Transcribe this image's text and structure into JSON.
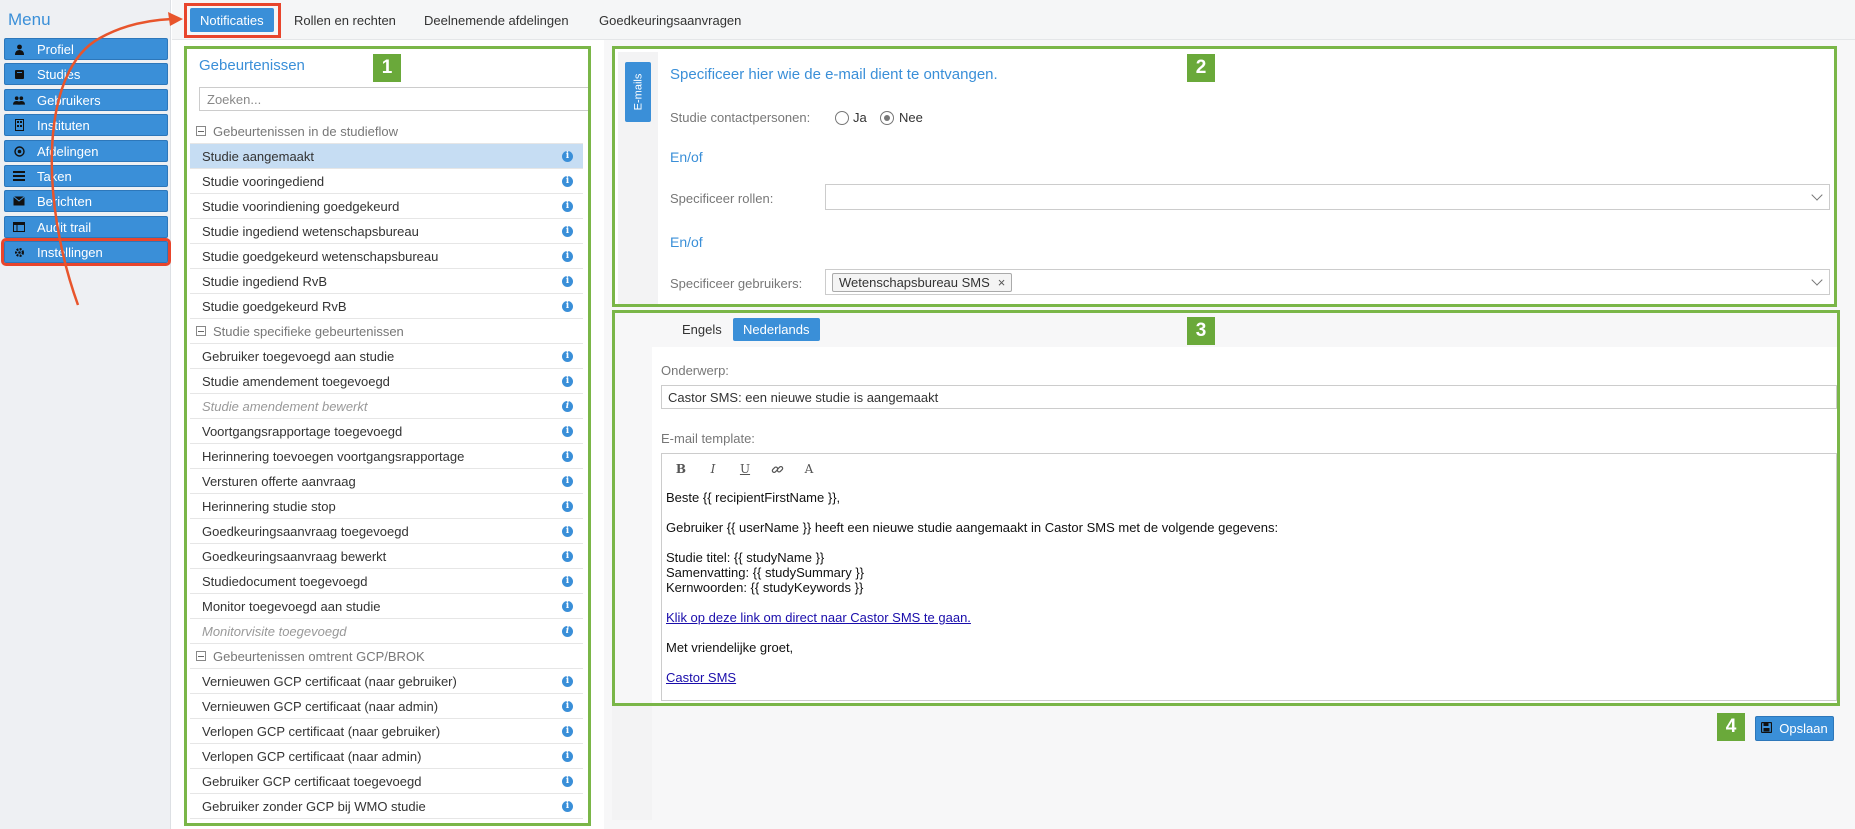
{
  "sidebar": {
    "title": "Menu",
    "items": [
      {
        "label": "Profiel",
        "icon": "user-icon"
      },
      {
        "label": "Studies",
        "icon": "book-icon"
      },
      {
        "label": "Gebruikers",
        "icon": "users-icon"
      },
      {
        "label": "Instituten",
        "icon": "building-icon"
      },
      {
        "label": "Afdelingen",
        "icon": "circle-dot-icon"
      },
      {
        "label": "Taken",
        "icon": "tasks-icon"
      },
      {
        "label": "Berichten",
        "icon": "envelope-icon"
      },
      {
        "label": "Audit trail",
        "icon": "table-icon"
      },
      {
        "label": "Instellingen",
        "icon": "gear-icon"
      }
    ],
    "active_item": "Instellingen"
  },
  "tabs": [
    "Notificaties",
    "Rollen en rechten",
    "Deelnemende afdelingen",
    "Goedkeuringsaanvragen"
  ],
  "active_tab": "Notificaties",
  "events_panel": {
    "title": "Gebeurtenissen",
    "search_placeholder": "Zoeken...",
    "groups": [
      {
        "label": "Gebeurtenissen in de studieflow",
        "items": [
          {
            "label": "Studie aangemaakt",
            "state": "selected"
          },
          {
            "label": "Studie vooringediend",
            "state": "normal"
          },
          {
            "label": "Studie voorindiening goedgekeurd",
            "state": "normal"
          },
          {
            "label": "Studie ingediend wetenschapsbureau",
            "state": "normal"
          },
          {
            "label": "Studie goedgekeurd wetenschapsbureau",
            "state": "normal"
          },
          {
            "label": "Studie ingediend RvB",
            "state": "normal"
          },
          {
            "label": "Studie goedgekeurd RvB",
            "state": "normal"
          }
        ]
      },
      {
        "label": "Studie specifieke gebeurtenissen",
        "items": [
          {
            "label": "Gebruiker toegevoegd aan studie",
            "state": "normal"
          },
          {
            "label": "Studie amendement toegevoegd",
            "state": "normal"
          },
          {
            "label": "Studie amendement bewerkt",
            "state": "disabled"
          },
          {
            "label": "Voortgangsrapportage toegevoegd",
            "state": "normal"
          },
          {
            "label": "Herinnering toevoegen voortgangsrapportage",
            "state": "normal"
          },
          {
            "label": "Versturen offerte aanvraag",
            "state": "normal"
          },
          {
            "label": "Herinnering studie stop",
            "state": "normal"
          },
          {
            "label": "Goedkeuringsaanvraag toegevoegd",
            "state": "normal"
          },
          {
            "label": "Goedkeuringsaanvraag bewerkt",
            "state": "normal"
          },
          {
            "label": "Studiedocument toegevoegd",
            "state": "normal"
          },
          {
            "label": "Monitor toegevoegd aan studie",
            "state": "normal"
          },
          {
            "label": "Monitorvisite toegevoegd",
            "state": "disabled"
          }
        ]
      },
      {
        "label": "Gebeurtenissen omtrent GCP/BROK",
        "items": [
          {
            "label": "Vernieuwen GCP certificaat (naar gebruiker)",
            "state": "normal"
          },
          {
            "label": "Vernieuwen GCP certificaat (naar admin)",
            "state": "normal"
          },
          {
            "label": "Verlopen GCP certificaat (naar gebruiker)",
            "state": "normal"
          },
          {
            "label": "Verlopen GCP certificaat (naar admin)",
            "state": "normal"
          },
          {
            "label": "Gebruiker GCP certificaat toegevoegd",
            "state": "normal"
          },
          {
            "label": "Gebruiker zonder GCP bij WMO studie",
            "state": "normal"
          }
        ]
      }
    ]
  },
  "recipients_panel": {
    "vertical_tab": "E-mails",
    "heading": "Specificeer hier wie de e-mail dient te ontvangen.",
    "contact_label": "Studie contactpersonen:",
    "radio_yes": "Ja",
    "radio_no": "Nee",
    "radio_selected": "Nee",
    "andor_1": "En/of",
    "roles_label": "Specificeer rollen:",
    "andor_2": "En/of",
    "users_label": "Specificeer gebruikers:",
    "users_tag": "Wetenschapsbureau SMS",
    "users_tag_remove": "×"
  },
  "template_panel": {
    "lang_tabs": [
      "Engels",
      "Nederlands"
    ],
    "active_lang": "Nederlands",
    "subject_label": "Onderwerp:",
    "subject_value": "Castor SMS: een nieuwe studie is aangemaakt",
    "template_label": "E-mail template:",
    "toolbar": {
      "bold": "B",
      "italic": "I",
      "underline": "U",
      "link": "link-icon",
      "font": "A"
    },
    "body": {
      "greeting": "Beste {{ recipientFirstName }},",
      "intro": "Gebruiker {{ userName }} heeft een nieuwe studie aangemaakt in Castor SMS met de volgende gegevens:",
      "line_title": "Studie titel: {{ studyName }}",
      "line_summary": "Samenvatting: {{ studySummary }}",
      "line_keywords": "Kernwoorden: {{ studyKeywords }}",
      "link_text": "Klik op deze link om direct naar Castor SMS te gaan.",
      "closing": "Met vriendelijke groet,",
      "signature_link": "Castor SMS"
    }
  },
  "save_button": {
    "label": "Opslaan",
    "icon": "save-icon"
  },
  "annotation_badges": [
    "1",
    "2",
    "3",
    "4"
  ],
  "colors": {
    "accent": "#3a8fd8",
    "annotation_green": "#7ab648",
    "annotation_red": "#e8452c",
    "badge_green": "#6aa93a",
    "selected_row": "#c6ddf3"
  }
}
